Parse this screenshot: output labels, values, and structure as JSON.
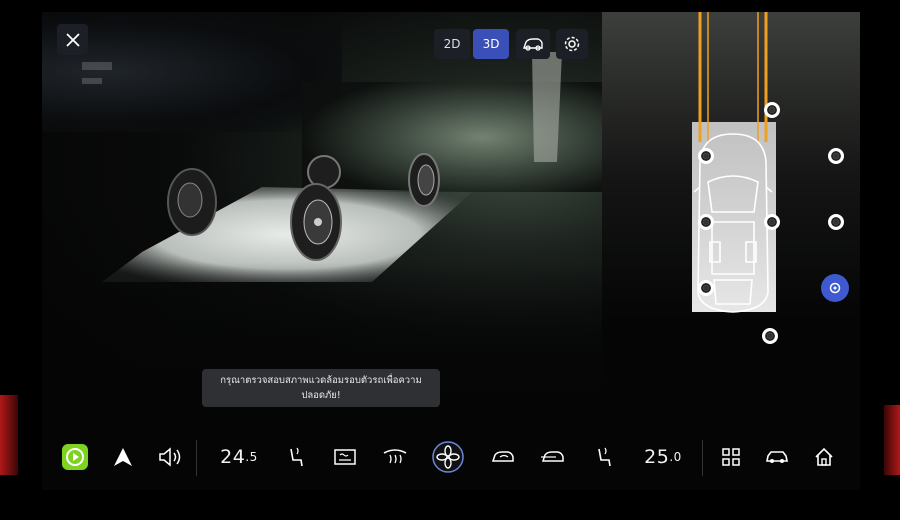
{
  "view_toggle": {
    "mode_2d": "2D",
    "mode_3d": "3D",
    "active": "3D"
  },
  "toast": {
    "line1": "กรุณาตรวจสอบสภาพแวดล้อมรอบตัวรถเพื่อความ",
    "line2": "ปลอดภัย!"
  },
  "climate": {
    "driver_temp_whole": "24",
    "driver_temp_decimal": ".5",
    "passenger_temp_whole": "25",
    "passenger_temp_decimal": ".0"
  },
  "icons": {
    "close": "close-icon",
    "view_angle": "car-view-angle-icon",
    "settings": "gear-icon",
    "carplay": "carplay-icon",
    "android_auto": "android-auto-icon",
    "volume": "volume-icon",
    "seat_heat_driver": "seat-heat-icon",
    "defrost_rear": "rear-defrost-icon",
    "defrost_front": "front-defrost-icon",
    "fan": "fan-icon",
    "air_recirculation": "recirculation-icon",
    "air_outside": "outside-air-icon",
    "seat_heat_passenger": "seat-heat-icon",
    "apps": "apps-grid-icon",
    "car": "car-icon",
    "home": "home-icon"
  },
  "colors": {
    "accent": "#3a4fb8",
    "selected_camera": "#3f5ad0",
    "carplay_green": "#7ed321",
    "guide_lines": "#f0a020"
  }
}
